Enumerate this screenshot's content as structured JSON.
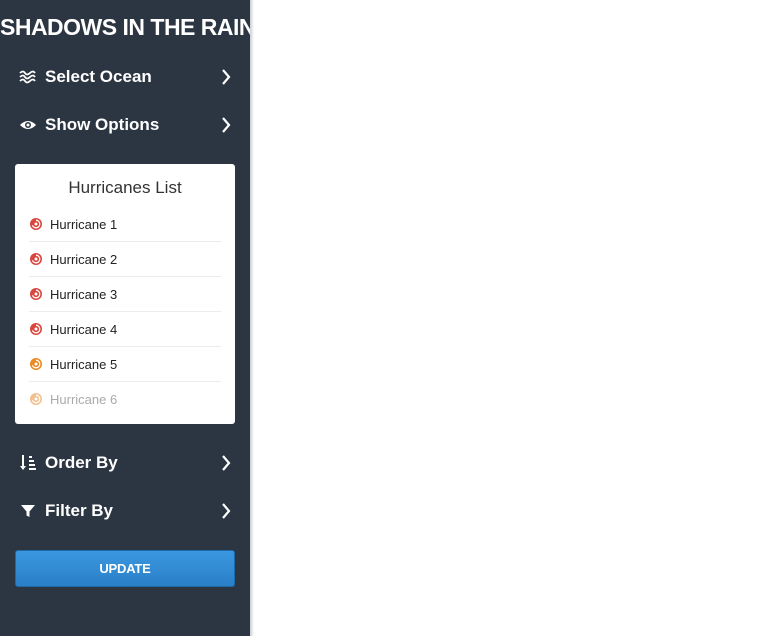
{
  "app": {
    "title": "SHADOWS IN THE RAIN"
  },
  "menu": {
    "select_ocean": {
      "label": "Select Ocean",
      "icon": "waves-icon"
    },
    "show_options": {
      "label": "Show Options",
      "icon": "eye-icon"
    },
    "order_by": {
      "label": "Order By",
      "icon": "sort-icon"
    },
    "filter_by": {
      "label": "Filter By",
      "icon": "filter-icon"
    }
  },
  "hurricanes": {
    "title": "Hurricanes List",
    "items": [
      {
        "label": "Hurricane 1",
        "color": "#d9463e"
      },
      {
        "label": "Hurricane 2",
        "color": "#d9463e"
      },
      {
        "label": "Hurricane 3",
        "color": "#d9463e"
      },
      {
        "label": "Hurricane 4",
        "color": "#d9463e"
      },
      {
        "label": "Hurricane 5",
        "color": "#ec8a22"
      },
      {
        "label": "Hurricane 6",
        "color": "#f2c08e"
      }
    ]
  },
  "update_button": {
    "label": "UPDATE"
  },
  "colors": {
    "sidebar": "#2c3542",
    "accent": "#2a7fc7"
  }
}
